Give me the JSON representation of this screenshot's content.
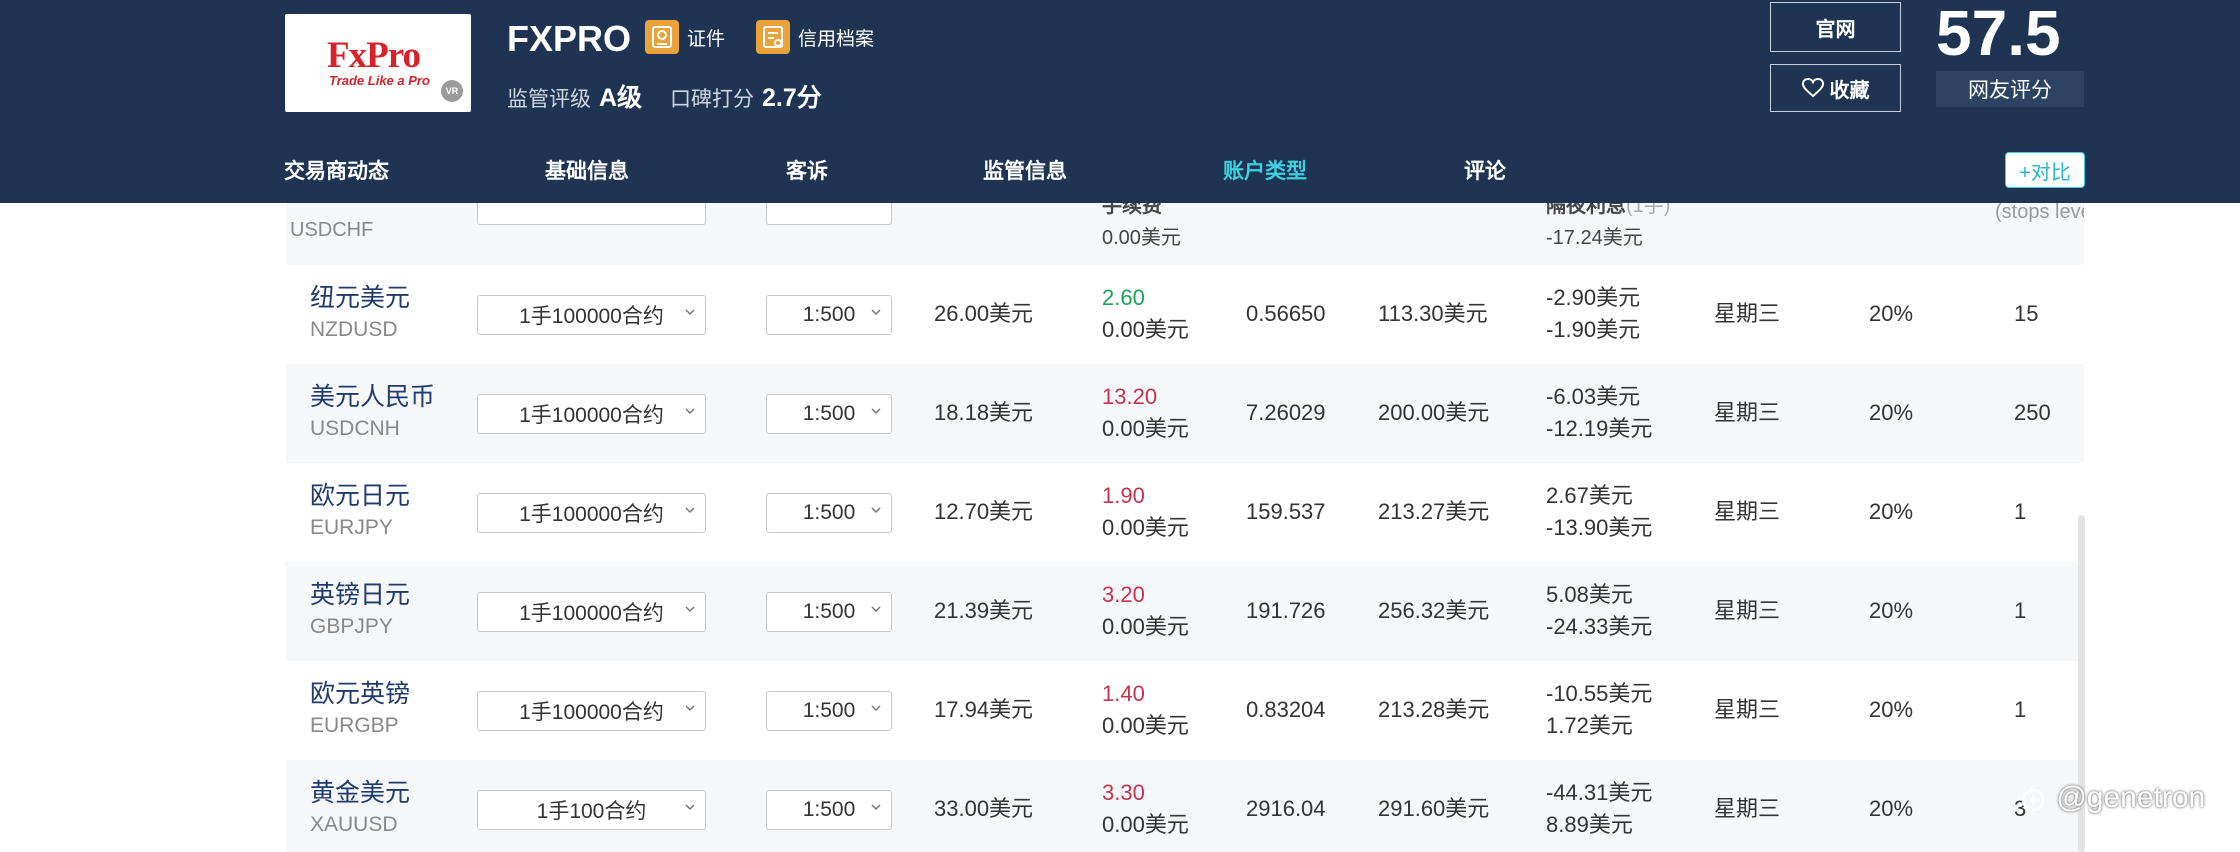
{
  "header": {
    "logo_text": "FxPro",
    "logo_tagline": "Trade Like a Pro",
    "logo_badge": "VR",
    "broker_name": "FXPRO",
    "chips": [
      {
        "label": "证件",
        "icon": "certificate-icon"
      },
      {
        "label": "信用档案",
        "icon": "credit-file-icon"
      }
    ],
    "regulation_label": "监管评级",
    "regulation_value": "A级",
    "reputation_label": "口碑打分",
    "reputation_value": "2.7分",
    "official_site_label": "官网",
    "favorite_label": "收藏",
    "score": "57.5",
    "score_label": "网友评分",
    "accent_color": "#3fd0e0",
    "bg_color": "#1f3453"
  },
  "nav": {
    "items": [
      "交易商动态",
      "基础信息",
      "客诉",
      "监管信息",
      "账户类型",
      "评论"
    ],
    "active": "账户类型",
    "compare_label": "+对比"
  },
  "table": {
    "partial_top": {
      "symbol_partial": "USDCHF",
      "fee_header": "手续费",
      "fee_value": "0.00美元",
      "overnight_header": "隔夜利息",
      "overnight_suffix": "(1手)",
      "overnight_value": "-17.24美元",
      "stops_header": "(stops leve"
    },
    "rows": [
      {
        "name_cn": "纽元美元",
        "name_en": "NZDUSD",
        "contract": "1手100000合约",
        "leverage": "1:500",
        "margin": "26.00美元",
        "spread": "2.60",
        "spread_color": "green",
        "commission": "0.00美元",
        "price": "0.56650",
        "point_value": "113.30美元",
        "swap_long": "-2.90美元",
        "swap_short": "-1.90美元",
        "triple_day": "星期三",
        "margin_ratio": "20%",
        "stops": "15"
      },
      {
        "name_cn": "美元人民币",
        "name_en": "USDCNH",
        "contract": "1手100000合约",
        "leverage": "1:500",
        "margin": "18.18美元",
        "spread": "13.20",
        "spread_color": "red",
        "commission": "0.00美元",
        "price": "7.26029",
        "point_value": "200.00美元",
        "swap_long": "-6.03美元",
        "swap_short": "-12.19美元",
        "triple_day": "星期三",
        "margin_ratio": "20%",
        "stops": "250"
      },
      {
        "name_cn": "欧元日元",
        "name_en": "EURJPY",
        "contract": "1手100000合约",
        "leverage": "1:500",
        "margin": "12.70美元",
        "spread": "1.90",
        "spread_color": "red",
        "commission": "0.00美元",
        "price": "159.537",
        "point_value": "213.27美元",
        "swap_long": "2.67美元",
        "swap_short": "-13.90美元",
        "triple_day": "星期三",
        "margin_ratio": "20%",
        "stops": "1"
      },
      {
        "name_cn": "英镑日元",
        "name_en": "GBPJPY",
        "contract": "1手100000合约",
        "leverage": "1:500",
        "margin": "21.39美元",
        "spread": "3.20",
        "spread_color": "red",
        "commission": "0.00美元",
        "price": "191.726",
        "point_value": "256.32美元",
        "swap_long": "5.08美元",
        "swap_short": "-24.33美元",
        "triple_day": "星期三",
        "margin_ratio": "20%",
        "stops": "1"
      },
      {
        "name_cn": "欧元英镑",
        "name_en": "EURGBP",
        "contract": "1手100000合约",
        "leverage": "1:500",
        "margin": "17.94美元",
        "spread": "1.40",
        "spread_color": "red",
        "commission": "0.00美元",
        "price": "0.83204",
        "point_value": "213.28美元",
        "swap_long": "-10.55美元",
        "swap_short": "1.72美元",
        "triple_day": "星期三",
        "margin_ratio": "20%",
        "stops": "1"
      },
      {
        "name_cn": "黄金美元",
        "name_en": "XAUUSD",
        "contract": "1手100合约",
        "leverage": "1:500",
        "margin": "33.00美元",
        "spread": "3.30",
        "spread_color": "red",
        "commission": "0.00美元",
        "price": "2916.04",
        "point_value": "291.60美元",
        "swap_long": "-44.31美元",
        "swap_short": "8.89美元",
        "triple_day": "星期三",
        "margin_ratio": "20%",
        "stops": "3"
      }
    ]
  },
  "watermark": "@genetron"
}
